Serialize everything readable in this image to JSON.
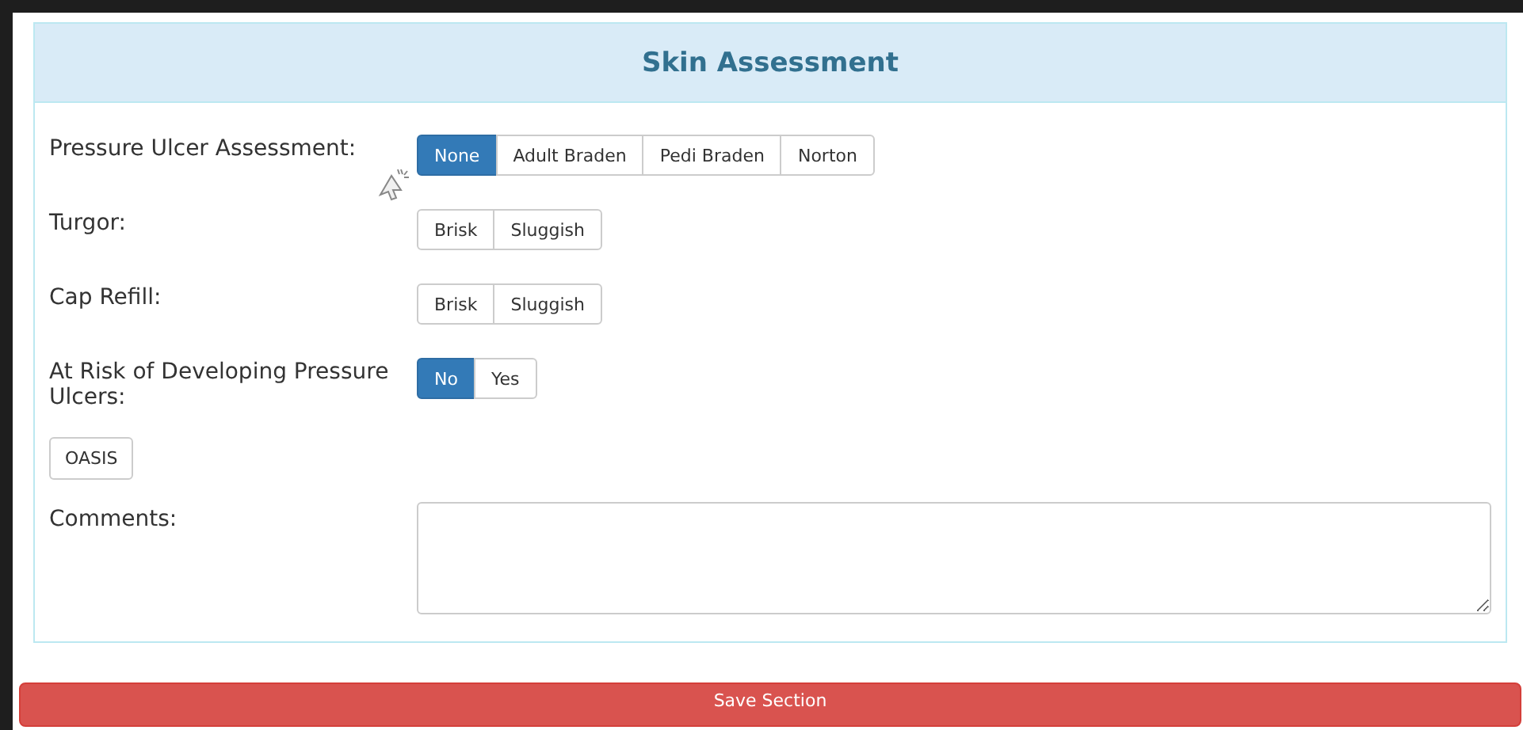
{
  "panel": {
    "title": "Skin Assessment"
  },
  "fields": [
    {
      "label": "Pressure Ulcer Assessment:",
      "options": [
        {
          "label": "None",
          "selected": true
        },
        {
          "label": "Adult Braden",
          "selected": false
        },
        {
          "label": "Pedi Braden",
          "selected": false
        },
        {
          "label": "Norton",
          "selected": false
        }
      ]
    },
    {
      "label": "Turgor:",
      "options": [
        {
          "label": "Brisk",
          "selected": false
        },
        {
          "label": "Sluggish",
          "selected": false
        }
      ]
    },
    {
      "label": "Cap Refill:",
      "options": [
        {
          "label": "Brisk",
          "selected": false
        },
        {
          "label": "Sluggish",
          "selected": false
        }
      ]
    },
    {
      "label": "At Risk of Developing Pressure Ulcers:",
      "options": [
        {
          "label": "No",
          "selected": true
        },
        {
          "label": "Yes",
          "selected": false
        }
      ]
    }
  ],
  "oasis_button": "OASIS",
  "comments": {
    "label": "Comments:"
  },
  "save_button": "Save Section"
}
